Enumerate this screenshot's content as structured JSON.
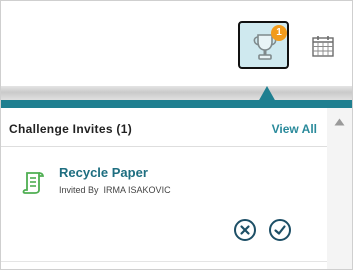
{
  "header": {
    "trophy_badge_count": "1",
    "trophy_icon": "trophy-icon",
    "calendar_icon": "calendar-icon"
  },
  "panel": {
    "title": "Challenge Invites (1)",
    "view_all_label": "View All",
    "invites": [
      {
        "icon": "document-icon",
        "title": "Recycle Paper",
        "invited_by_label": "Invited By",
        "invited_by_name": "IRMA ISAKOVIC"
      }
    ]
  },
  "colors": {
    "accent": "#1f7f90",
    "badge": "#f29b1b",
    "trophy_button_bg": "#cfe9ef",
    "link": "#2a8a9b",
    "doc_icon": "#4fae52"
  }
}
